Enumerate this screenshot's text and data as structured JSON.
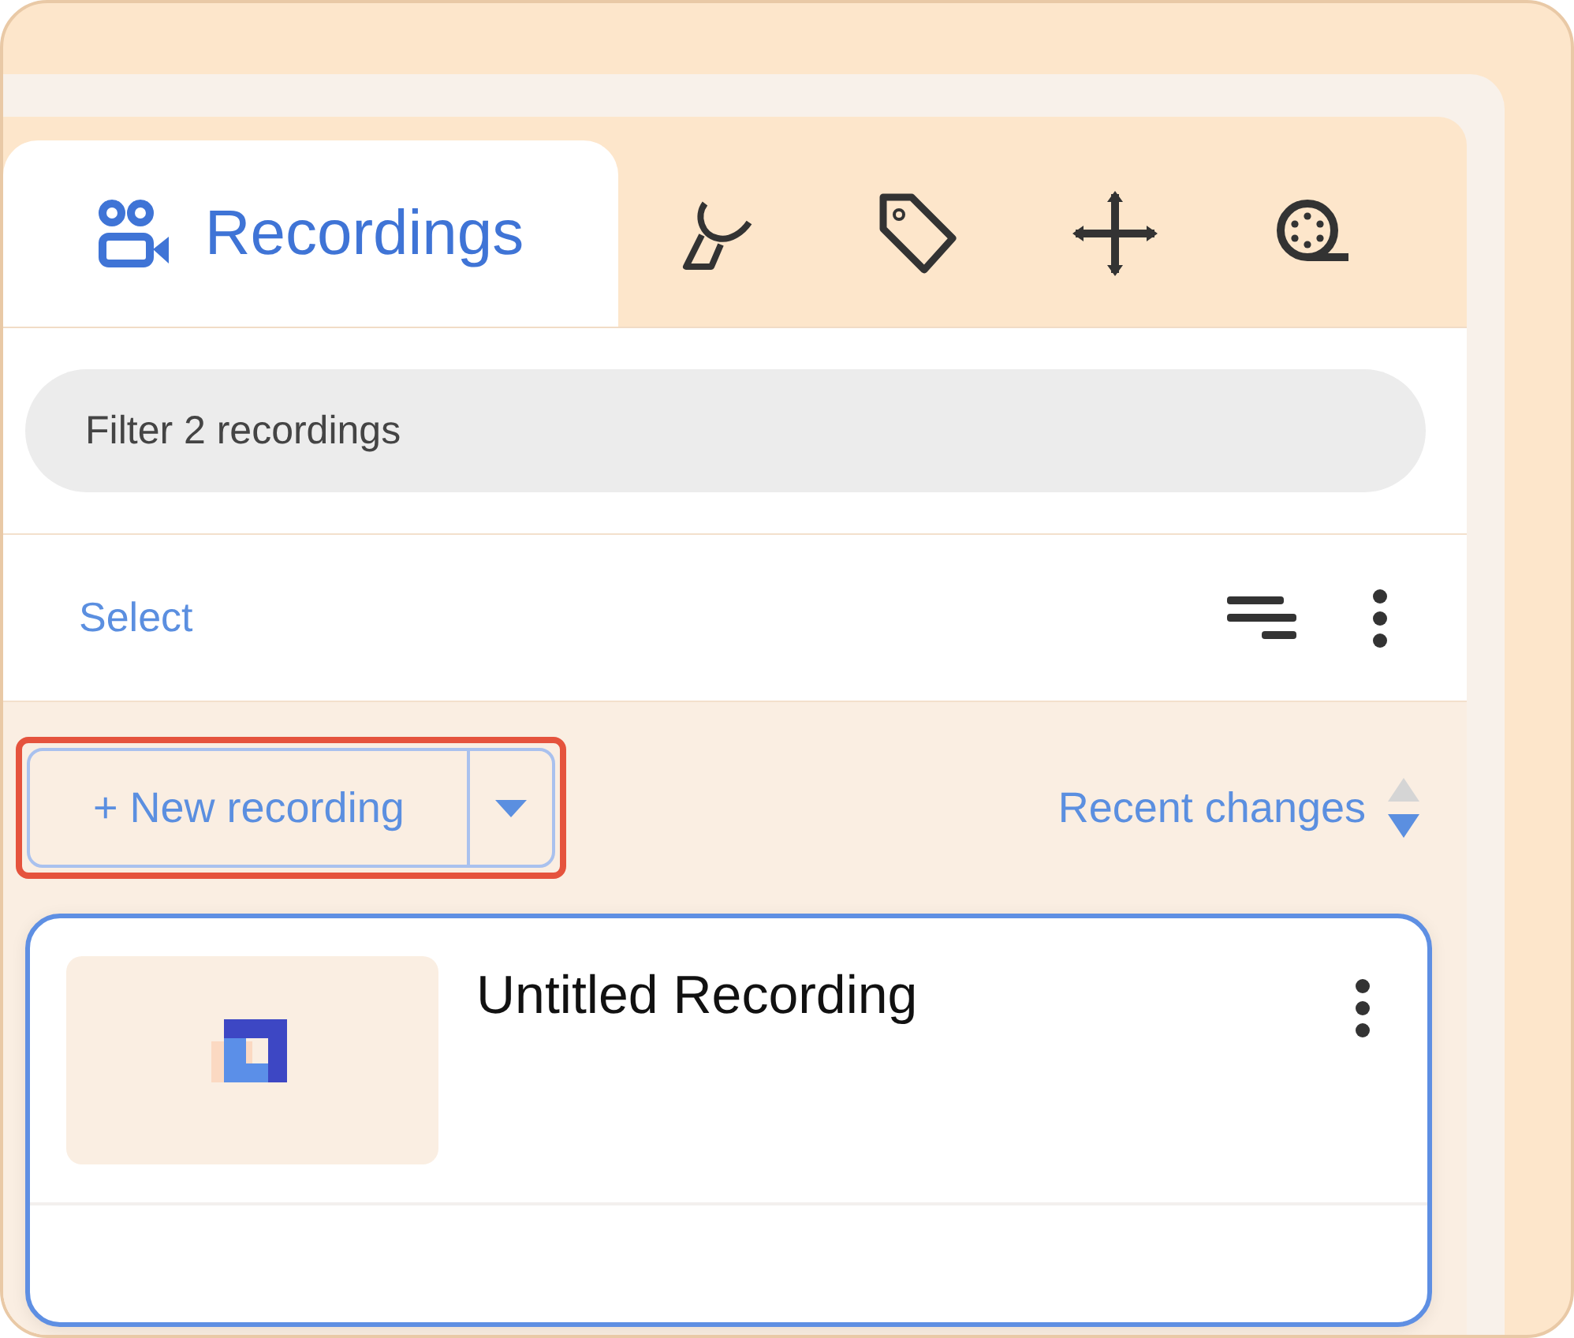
{
  "tabs": [
    {
      "label": "Recordings",
      "selected": true
    },
    {
      "selected": false
    },
    {
      "selected": false
    },
    {
      "selected": false
    },
    {
      "selected": false
    }
  ],
  "filter": {
    "placeholder": "Filter 2 recordings"
  },
  "toolbar": {
    "select_link": "Select"
  },
  "new_recording": {
    "label": "+ New recording",
    "highlighted": true
  },
  "sort": {
    "label": "Recent changes",
    "descending": true
  },
  "recordings": [
    {
      "title": "Untitled Recording",
      "selected": true
    }
  ]
}
